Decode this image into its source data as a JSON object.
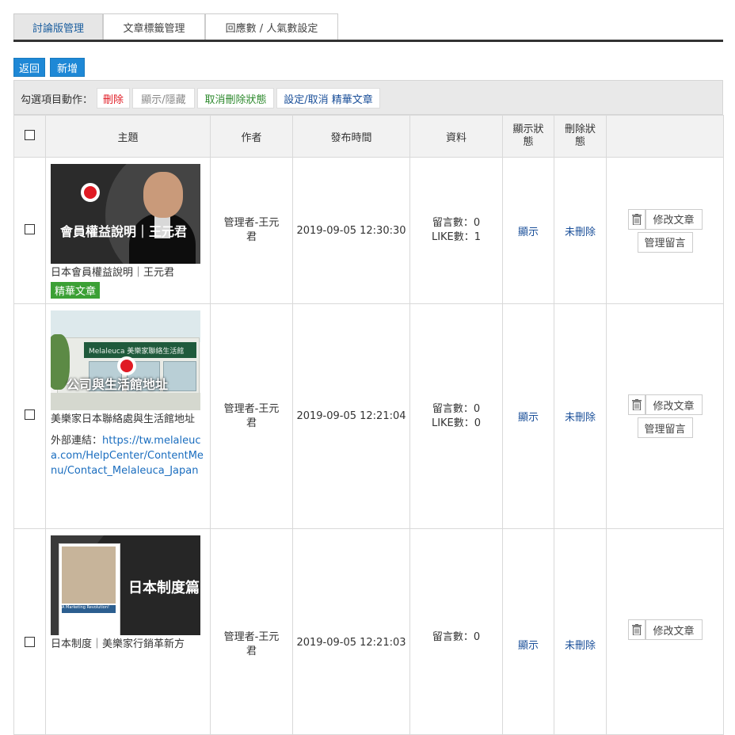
{
  "tabs": [
    {
      "label": "討論版管理",
      "active": true
    },
    {
      "label": "文章標籤管理",
      "active": false
    },
    {
      "label": "回應數 / 人氣數設定",
      "active": false
    }
  ],
  "buttons": {
    "back": "返回",
    "add": "新增"
  },
  "bulk": {
    "label": "勾選項目動作：",
    "delete": "刪除",
    "toggle_visibility": "顯示/隱藏",
    "undelete": "取消刪除狀態",
    "featured": "設定/取消 精華文章"
  },
  "columns": [
    "主題",
    "作者",
    "發布時間",
    "資料",
    "顯示狀態",
    "刪除狀態"
  ],
  "rows": [
    {
      "thumb_title": "會員權益說明｜王元君",
      "title": "日本會員權益說明｜王元君",
      "badge": "精華文章",
      "author": "管理者-王元君",
      "time": "2019-09-05 12:30:30",
      "comments": "留言數：0",
      "likes": "LIKE數：1",
      "display": "顯示",
      "deleted": "未刪除",
      "edit": "修改文章",
      "manage": "管理留言"
    },
    {
      "thumb_title": "公司與生活館地址",
      "thumb_sign": "Melaleuca 美樂家聯絡生活館",
      "title": "美樂家日本聯絡處與生活館地址",
      "link_label": "外部連結：",
      "link": "https://tw.melaleuca.com/HelpCenter/ContentMenu/Contact_Melaleuca_Japan",
      "author": "管理者-王元君",
      "time": "2019-09-05 12:21:04",
      "comments": "留言數：0",
      "likes": "LIKE數：0",
      "display": "顯示",
      "deleted": "未刪除",
      "edit": "修改文章",
      "manage": "管理留言"
    },
    {
      "thumb_title": "日本制度篇",
      "thumb_band": "A Marketing Revolution!",
      "title": "日本制度｜美樂家行銷革新方",
      "author": "管理者-王元君",
      "time": "2019-09-05 12:21:03",
      "comments": "留言數：0",
      "display": "顯示",
      "deleted": "未刪除",
      "edit": "修改文章"
    }
  ],
  "colors": {
    "primary": "#1e88d6",
    "danger": "#e01b24",
    "success": "#3ba035",
    "link": "#1a4f99"
  }
}
